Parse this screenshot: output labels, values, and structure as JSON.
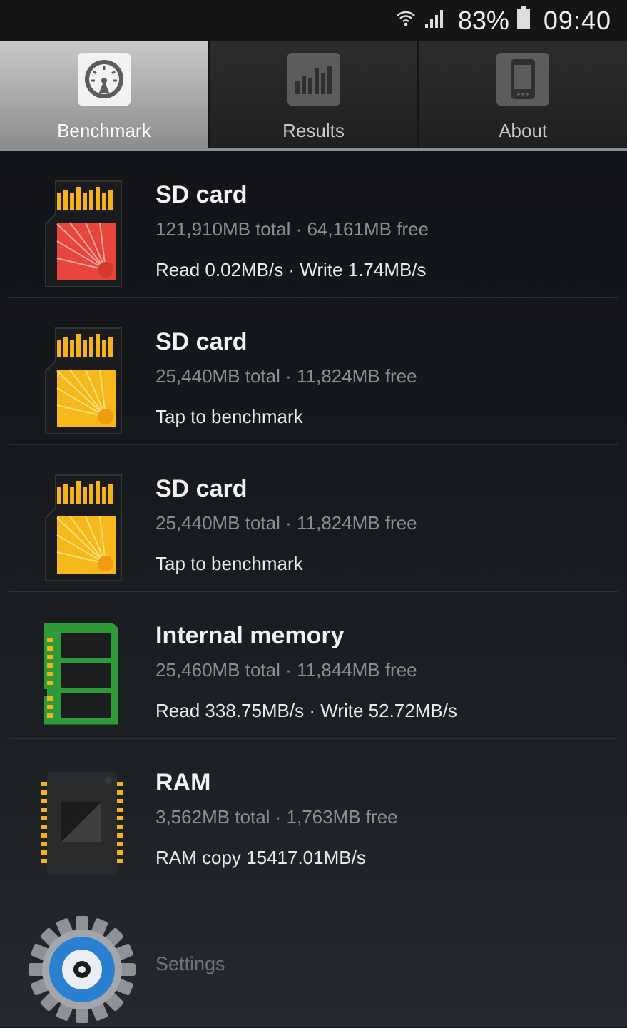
{
  "status_bar": {
    "battery": "83%",
    "time": "09:40"
  },
  "tabs": [
    {
      "label": "Benchmark",
      "icon": "speedometer-icon",
      "active": true
    },
    {
      "label": "Results",
      "icon": "bar-chart-icon",
      "active": false
    },
    {
      "label": "About",
      "icon": "phone-icon",
      "active": false
    }
  ],
  "items": [
    {
      "title": "SD card",
      "sub": "121,910MB total · 64,161MB free",
      "action": "Read 0.02MB/s · Write 1.74MB/s",
      "icon": "sd-card-red-icon"
    },
    {
      "title": "SD card",
      "sub": "25,440MB total · 11,824MB free",
      "action": "Tap to benchmark",
      "icon": "sd-card-yellow-icon"
    },
    {
      "title": "SD card",
      "sub": "25,440MB total · 11,824MB free",
      "action": "Tap to benchmark",
      "icon": "sd-card-yellow-icon"
    },
    {
      "title": "Internal memory",
      "sub": "25,460MB total · 11,844MB free",
      "action": "Read 338.75MB/s · Write 52.72MB/s",
      "icon": "memory-module-icon"
    },
    {
      "title": "RAM",
      "sub": "3,562MB total · 1,763MB free",
      "action": "RAM copy 15417.01MB/s",
      "icon": "ram-chip-icon"
    }
  ],
  "settings": {
    "label": "Settings",
    "icon": "gear-icon"
  },
  "colors": {
    "sd_red": "#e8463c",
    "sd_yellow": "#f7b81c",
    "pcb_green": "#2e9a3a",
    "gear_blue": "#2a7fd0"
  }
}
